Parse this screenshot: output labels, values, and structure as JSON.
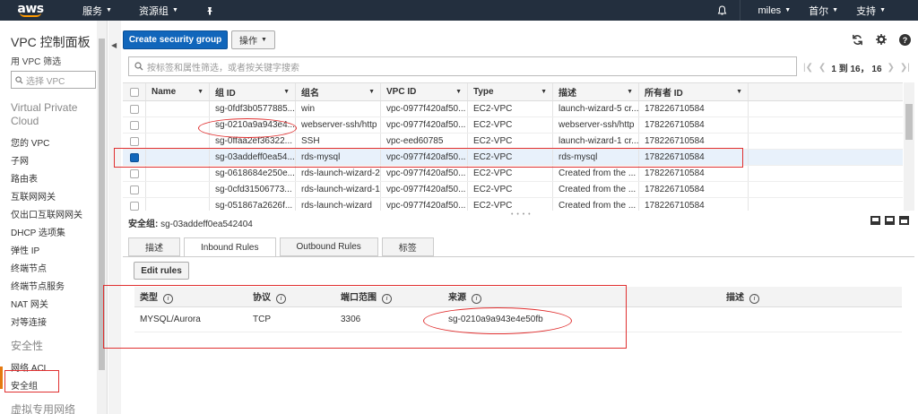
{
  "topnav": {
    "logo": "aws",
    "services": "服务",
    "resource_groups": "资源组",
    "user": "miles",
    "region": "首尔",
    "support": "支持"
  },
  "sidebar": {
    "title": "VPC 控制面板",
    "filter_label": "用 VPC 筛选",
    "filter_placeholder": "选择 VPC",
    "section1": "Virtual Private Cloud",
    "items1": [
      "您的 VPC",
      "子网",
      "路由表",
      "互联网网关",
      "仅出口互联网网关",
      "DHCP 选项集",
      "弹性 IP",
      "终端节点",
      "终端节点服务",
      "NAT 网关",
      "对等连接"
    ],
    "section2": "安全性",
    "items2": [
      "网络 ACL",
      "安全组"
    ],
    "section3": "虚拟专用网络"
  },
  "toolbar": {
    "create_label": "Create security group",
    "actions_label": "操作"
  },
  "search": {
    "placeholder": "按标签和属性筛选，或者按关键字搜索"
  },
  "pager": {
    "text": "1 到 16， 16"
  },
  "grid": {
    "columns": [
      "Name",
      "组 ID",
      "组名",
      "VPC ID",
      "Type",
      "描述",
      "所有者 ID"
    ],
    "rows": [
      {
        "name": "",
        "group_id": "sg-0fdf3b0577885...",
        "group_name": "win",
        "vpc_id": "vpc-0977f420af50...",
        "type": "EC2-VPC",
        "desc": "launch-wizard-5 cr...",
        "owner": "178226710584",
        "selected": false
      },
      {
        "name": "",
        "group_id": "sg-0210a9a943e4...",
        "group_name": "webserver-ssh/http",
        "vpc_id": "vpc-0977f420af50...",
        "type": "EC2-VPC",
        "desc": "webserver-ssh/http",
        "owner": "178226710584",
        "selected": false
      },
      {
        "name": "",
        "group_id": "sg-0ffaa2ef36322...",
        "group_name": "SSH",
        "vpc_id": "vpc-eed60785",
        "type": "EC2-VPC",
        "desc": "launch-wizard-1 cr...",
        "owner": "178226710584",
        "selected": false
      },
      {
        "name": "",
        "group_id": "sg-03addeff0ea54...",
        "group_name": "rds-mysql",
        "vpc_id": "vpc-0977f420af50...",
        "type": "EC2-VPC",
        "desc": "rds-mysql",
        "owner": "178226710584",
        "selected": true
      },
      {
        "name": "",
        "group_id": "sg-0618684e250e...",
        "group_name": "rds-launch-wizard-2",
        "vpc_id": "vpc-0977f420af50...",
        "type": "EC2-VPC",
        "desc": "Created from the ...",
        "owner": "178226710584",
        "selected": false
      },
      {
        "name": "",
        "group_id": "sg-0cfd31506773...",
        "group_name": "rds-launch-wizard-1",
        "vpc_id": "vpc-0977f420af50...",
        "type": "EC2-VPC",
        "desc": "Created from the ...",
        "owner": "178226710584",
        "selected": false
      },
      {
        "name": "",
        "group_id": "sg-051867a2626f...",
        "group_name": "rds-launch-wizard",
        "vpc_id": "vpc-0977f420af50...",
        "type": "EC2-VPC",
        "desc": "Created from the ...",
        "owner": "178226710584",
        "selected": false
      }
    ]
  },
  "detail": {
    "label": "安全组:",
    "group_id": "sg-03addeff0ea542404",
    "tabs": [
      "描述",
      "Inbound Rules",
      "Outbound Rules",
      "标签"
    ],
    "edit_rules": "Edit rules",
    "rule_columns": [
      "类型",
      "协议",
      "端口范围",
      "来源",
      "描述"
    ],
    "rules": [
      {
        "type": "MYSQL/Aurora",
        "protocol": "TCP",
        "port": "3306",
        "source": "sg-0210a9a943e4e50fb",
        "desc": ""
      }
    ]
  }
}
